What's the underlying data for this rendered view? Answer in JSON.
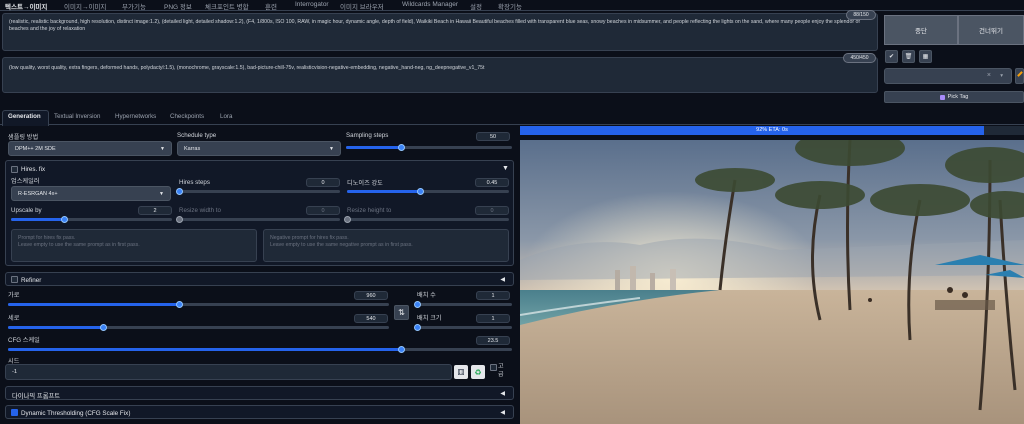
{
  "tabs": [
    "텍스트→이미지",
    "이미지→이미지",
    "부가기능",
    "PNG 정보",
    "체크포인트 병합",
    "훈련",
    "Interrogator",
    "이미지 브라우저",
    "Wildcards Manager",
    "설정",
    "확장기능"
  ],
  "prompt": {
    "positive": "(realistic, realistic background, high resolution, distinct image:1.2), (detailed light, detailed shadow:1.2), (F4, 1/800s, ISO 100, RAW, in magic hour, dynamic angle, depth of field), Waikiki Beach in Hawaii Beautiful beaches filled with transparent blue seas, snowy beaches in midsummer, and people reflecting the lights on the sand, where many people enjoy the splendor of beaches and the joy of relaxation",
    "positive_count": "88/150",
    "negative": "(low quality, worst quality, extra fingers, deformed hands, polydactyl:1.5), (monochrome, grayscale:1.5), bad-picture-chill-75v, realisticvision-negative-embedding, negative_hand-neg, ng_deepnegative_v1_75t",
    "negative_count": "450/450"
  },
  "actions": {
    "interrupt": "중단",
    "skip": "건너뛰기",
    "icons": [
      "✔",
      "🗑",
      "▦"
    ],
    "style_close": "×",
    "style_caret": "▾",
    "pick_tag": "Pick Tag"
  },
  "subtabs": [
    "Generation",
    "Textual Inversion",
    "Hypernetworks",
    "Checkpoints",
    "Lora"
  ],
  "generation": {
    "sampler_label": "샘플링 방법",
    "sampler_value": "DPM++ 2M SDE",
    "schedule_label": "Schedule type",
    "schedule_value": "Karras",
    "steps_label": "Sampling steps",
    "steps_value": "50",
    "steps_fraction": 0.33,
    "hires": {
      "title": "Hires. fix",
      "upscaler_label": "업스케일러",
      "upscaler_value": "R-ESRGAN 4x+",
      "hires_steps_label": "Hires steps",
      "hires_steps_value": "0",
      "denoise_label": "디노이즈 강도",
      "denoise_value": "0.45",
      "upscale_by_label": "Upscale by",
      "upscale_by_value": "2",
      "resize_w_label": "Resize width to",
      "resize_w_value": "0",
      "resize_h_label": "Resize height to",
      "resize_h_value": "0",
      "prompt_placeholder_1": "Prompt for hires fix pass.",
      "prompt_placeholder_2": "Leave empty to use the same prompt as in first pass.",
      "neg_placeholder_1": "Negative prompt for hires fix pass.",
      "neg_placeholder_2": "Leave empty to use the same negative prompt as in first pass."
    },
    "refiner_title": "Refiner",
    "width_label": "가로",
    "width_value": "960",
    "height_label": "세로",
    "height_value": "540",
    "swap_icon": "⇅",
    "batch_count_label": "배치 수",
    "batch_count_value": "1",
    "batch_size_label": "배치 크기",
    "batch_size_value": "1",
    "cfg_label": "CFG 스케일",
    "cfg_value": "23.5",
    "seed_label": "시드",
    "seed_value": "-1",
    "extra_label": "고급",
    "dynamic_prompts": "다이나믹 프롬프트",
    "dynamic_thresholding": "Dynamic Thresholding (CFG Scale Fix)"
  },
  "progress": {
    "text": "92% ETA: 0s",
    "fraction": 0.92
  },
  "colors": {
    "accent": "#2563eb",
    "bg": "#0b0f19",
    "panel": "#111827"
  }
}
